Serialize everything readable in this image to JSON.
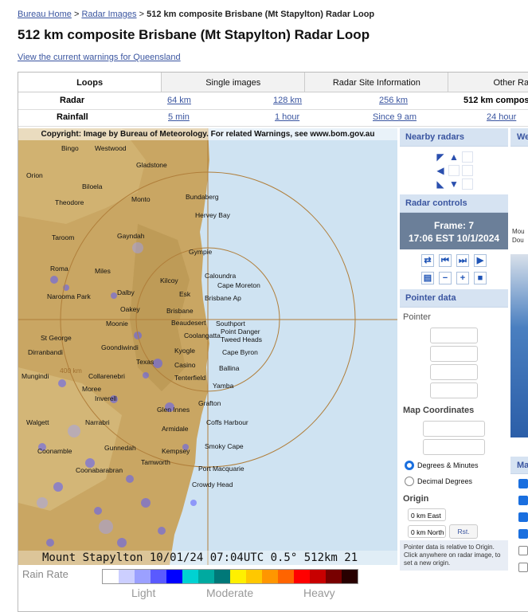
{
  "breadcrumb": {
    "home": "Bureau Home",
    "sep1": ">",
    "images": "Radar Images",
    "sep2": ">",
    "current": "512 km composite Brisbane (Mt Stapylton) Radar Loop"
  },
  "page_title": "512 km composite Brisbane (Mt Stapylton) Radar Loop",
  "warnings_link": "View the current warnings for Queensland",
  "tabs": [
    "Loops",
    "Single images",
    "Radar Site Information",
    "Other Ra"
  ],
  "radar_row": {
    "label": "Radar",
    "o1": "64 km",
    "o2": "128 km",
    "o3": "256 km",
    "current": "512 km compos"
  },
  "rainfall_row": {
    "label": "Rainfall",
    "o1": "5 min",
    "o2": "1 hour",
    "o3": "Since 9 am",
    "o4": "24 hour"
  },
  "radar_image": {
    "copyright": "Copyright: Image by Bureau of Meteorology. For related Warnings, see www.bom.gov.au",
    "caption": "Mount Stapylton 10/01/24 07:04UTC 0.5° 512km 21",
    "range_label": "400 km",
    "towns": [
      "Bingo",
      "Westwood",
      "Gladstone",
      "Orion",
      "Biloela",
      "Theodore",
      "Monto",
      "Bundaberg",
      "Hervey Bay",
      "Taroom",
      "Gayndah",
      "Gympie",
      "Miles",
      "Kilcoy",
      "Caloundra",
      "Cape Moreton",
      "Roma",
      "Dalby",
      "Esk",
      "Brisbane Ap",
      "Oakey",
      "Brisbane",
      "Moonie",
      "Beaudesert",
      "Southport",
      "Point Danger",
      "Tweed Heads",
      "St George",
      "Goondiwindi",
      "Coolangatta",
      "Kyogle",
      "Cape Byron",
      "Dirranbandi",
      "Texas",
      "Casino",
      "Ballina",
      "Mungindi",
      "Collarenebri",
      "Tenterfield",
      "Moree",
      "Yamba",
      "Inverell",
      "Grafton",
      "Walgett",
      "Narrabri",
      "Glen Innes",
      "Coffs Harbour",
      "Gunnedah",
      "Armidale",
      "Kempsey",
      "Smoky Cape",
      "Coonamble",
      "Coonabarabran",
      "Tamworth",
      "Port Macquarie",
      "Crowdy Head",
      "Narooma Park"
    ]
  },
  "rain_rate": {
    "label": "Rain Rate",
    "light": "Light",
    "moderate": "Moderate",
    "heavy": "Heavy",
    "colors": [
      "#ffffff",
      "#cccfff",
      "#9ba0ff",
      "#5a5aff",
      "#0000ff",
      "#00d2d2",
      "#00aaa0",
      "#007878",
      "#fff000",
      "#ffc800",
      "#ff9600",
      "#ff6400",
      "#ff0000",
      "#c80000",
      "#780000",
      "#280000"
    ]
  },
  "sidebar": {
    "nearby": "Nearby radars",
    "controls": "Radar controls",
    "frame_line1": "Frame: 7",
    "frame_line2": "17:06 EST 10/1/2024",
    "pointer_data": "Pointer data",
    "pointer": "Pointer",
    "map_coords": "Map Coordinates",
    "deg_min": "Degrees & Minutes",
    "dec_deg": "Decimal Degrees",
    "origin": "Origin",
    "origin_e": "0 km East",
    "origin_n": "0 km North",
    "reset": "Rst.",
    "note": "Pointer data is relative to Origin. Click anywhere on radar image, to set a new origin."
  },
  "right_panel": {
    "header": "We",
    "mou": "Mou",
    "dou": "Dou",
    "map": "Ma"
  }
}
